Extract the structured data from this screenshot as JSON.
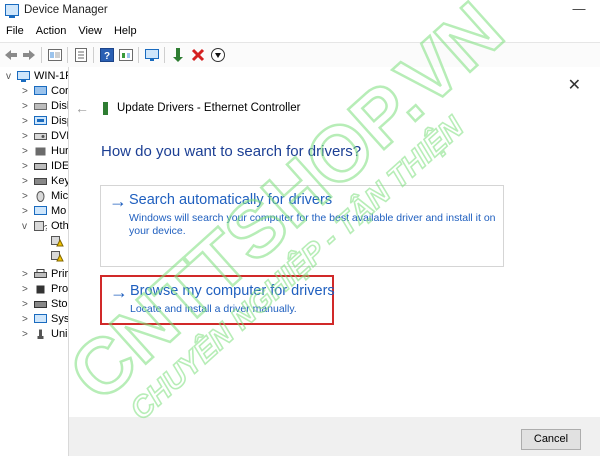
{
  "window": {
    "title": "Device Manager",
    "minimize_glyph": "—"
  },
  "menu": [
    "File",
    "Action",
    "View",
    "Help"
  ],
  "toolbar_icons": [
    "back-arrow-icon",
    "forward-arrow-icon",
    "grid-view-icon",
    "properties-icon",
    "help-icon",
    "update-driver-icon",
    "scan-hardware-icon",
    "enable-device-icon",
    "uninstall-device-icon",
    "download-icon"
  ],
  "tree": {
    "root": "WIN-1F",
    "items": [
      {
        "label": "Cor",
        "chev": ">"
      },
      {
        "label": "Disl",
        "chev": ">"
      },
      {
        "label": "Disp",
        "chev": ">"
      },
      {
        "label": "DVI",
        "chev": ">"
      },
      {
        "label": "Hur",
        "chev": ">"
      },
      {
        "label": "IDE",
        "chev": ">"
      },
      {
        "label": "Key",
        "chev": ">"
      },
      {
        "label": "Mic",
        "chev": ">"
      },
      {
        "label": "Mo",
        "chev": ">"
      },
      {
        "label": "Oth",
        "chev": "v"
      },
      {
        "label": "",
        "chev": ""
      },
      {
        "label": "",
        "chev": ""
      },
      {
        "label": "Prir",
        "chev": ">"
      },
      {
        "label": "Pro",
        "chev": ">"
      },
      {
        "label": "Sto",
        "chev": ">"
      },
      {
        "label": "Sys",
        "chev": ">"
      },
      {
        "label": "Uni",
        "chev": ">"
      }
    ]
  },
  "dialog": {
    "close_glyph": "✕",
    "back_glyph": "←",
    "title": "Update Drivers - Ethernet Controller",
    "heading": "How do you want to search for drivers?",
    "options": [
      {
        "arrow": "→",
        "title": "Search automatically for drivers",
        "desc": "Windows will search your computer for the best available driver and install it on your device."
      },
      {
        "arrow": "→",
        "title": "Browse my computer for drivers",
        "desc": "Locate and install a driver manually."
      }
    ],
    "cancel_label": "Cancel"
  },
  "watermark": {
    "main": "CNTTSHOP.VN",
    "sub": "CHUYÊN NGHIỆP - TẬN THIỆN"
  },
  "colors": {
    "link_blue": "#1f5fbf",
    "heading_blue": "#1c3f94",
    "highlight_red": "#d12929",
    "watermark_green": "#7ee07e"
  }
}
